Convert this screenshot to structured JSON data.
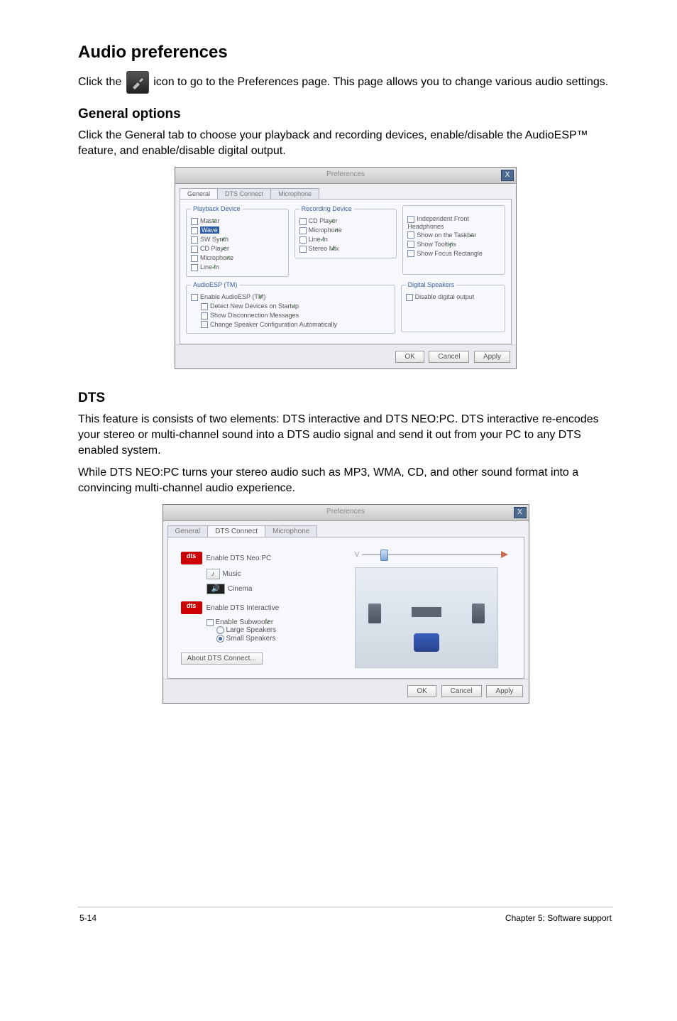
{
  "h_audio": "Audio preferences",
  "para1_a": "Click the ",
  "para1_b": " icon to go to the Preferences page. This page allows you to change various audio settings.",
  "h_general": "General options",
  "para2": "Click the General tab to choose your playback and recording devices, enable/disable the AudioESP™ feature, and enable/disable digital output.",
  "dlg1": {
    "title": "Preferences",
    "tabs": [
      "General",
      "DTS Connect",
      "Microphone"
    ],
    "legend_playback": "Playback Device",
    "playback": [
      "Master",
      "Wave",
      "SW Synth",
      "CD Player",
      "Microphone",
      "Line In"
    ],
    "legend_recording": "Recording Device",
    "recording": [
      "CD Player",
      "Microphone",
      "Line In",
      "Stereo Mix"
    ],
    "right": [
      {
        "label": "Independent Front Headphones",
        "checked": false
      },
      {
        "label": "Show on the Taskbar",
        "checked": true
      },
      {
        "label": "Show Tooltips",
        "checked": true
      },
      {
        "label": "Show Focus Rectangle",
        "checked": false
      }
    ],
    "legend_audioesp": "AudioESP (TM)",
    "audioesp": [
      {
        "label": "Enable AudioESP (TM)",
        "checked": true
      },
      {
        "label": "Detect New Devices on Startup",
        "checked": true
      },
      {
        "label": "Show Disconnection Messages",
        "checked": false
      },
      {
        "label": "Change Speaker Configuration Automatically",
        "checked": false
      }
    ],
    "legend_digital": "Digital Speakers",
    "digital": {
      "label": "Disable digital output",
      "checked": false
    },
    "btn_ok": "OK",
    "btn_cancel": "Cancel",
    "btn_apply": "Apply"
  },
  "h_dts": "DTS",
  "para3": "This feature is consists of two elements: DTS interactive and DTS NEO:PC. DTS interactive re-encodes your stereo or multi-channel sound into a DTS audio signal and send it out from your PC to any DTS enabled system.",
  "para4": "While DTS NEO:PC turns your stereo audio such as MP3, WMA, CD, and other sound format into a convincing multi-channel audio experience.",
  "dlg2": {
    "title": "Preferences",
    "tabs": [
      "General",
      "DTS Connect",
      "Microphone"
    ],
    "dts_logo": "dts",
    "neo_label": "Enable DTS Neo:PC",
    "music": "Music",
    "cinema": "Cinema",
    "interactive": "Enable DTS Interactive",
    "sub": "Enable Subwoofer",
    "large": "Large Speakers",
    "small": "Small Speakers",
    "about": "About DTS Connect...",
    "btn_ok": "OK",
    "btn_cancel": "Cancel",
    "btn_apply": "Apply",
    "slider_label": "V"
  },
  "footer_left": "5-14",
  "footer_right": "Chapter 5: Software support"
}
